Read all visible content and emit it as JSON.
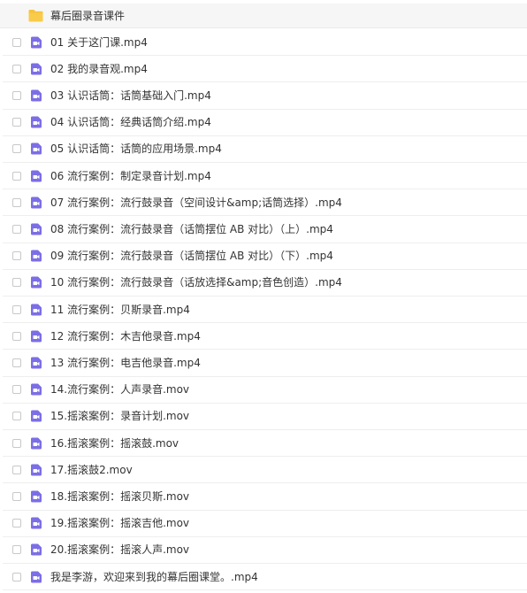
{
  "colors": {
    "folder": "#f7c33c",
    "video": "#7b6ee6",
    "text": "#333333"
  },
  "folder": {
    "icon": "folder-icon",
    "name": "幕后圈录音课件"
  },
  "files": [
    {
      "icon": "video-file-icon",
      "name": "01 关于这门课.mp4"
    },
    {
      "icon": "video-file-icon",
      "name": "02 我的录音观.mp4"
    },
    {
      "icon": "video-file-icon",
      "name": "03 认识话筒：话筒基础入门.mp4"
    },
    {
      "icon": "video-file-icon",
      "name": "04 认识话筒：经典话筒介绍.mp4"
    },
    {
      "icon": "video-file-icon",
      "name": "05 认识话筒：话筒的应用场景.mp4"
    },
    {
      "icon": "video-file-icon",
      "name": "06 流行案例：制定录音计划.mp4"
    },
    {
      "icon": "video-file-icon",
      "name": "07 流行案例：流行鼓录音（空间设计&amp;话筒选择）.mp4"
    },
    {
      "icon": "video-file-icon",
      "name": "08 流行案例：流行鼓录音（话筒摆位 AB 对比）（上）.mp4"
    },
    {
      "icon": "video-file-icon",
      "name": "09 流行案例：流行鼓录音（话筒摆位 AB 对比）（下）.mp4"
    },
    {
      "icon": "video-file-icon",
      "name": "10 流行案例：流行鼓录音（话放选择&amp;音色创造）.mp4"
    },
    {
      "icon": "video-file-icon",
      "name": "11 流行案例：贝斯录音.mp4"
    },
    {
      "icon": "video-file-icon",
      "name": "12 流行案例：木吉他录音.mp4"
    },
    {
      "icon": "video-file-icon",
      "name": "13 流行案例：电吉他录音.mp4"
    },
    {
      "icon": "video-file-icon",
      "name": "14.流行案例：人声录音.mov"
    },
    {
      "icon": "video-file-icon",
      "name": "15.摇滚案例：录音计划.mov"
    },
    {
      "icon": "video-file-icon",
      "name": "16.摇滚案例：摇滚鼓.mov"
    },
    {
      "icon": "video-file-icon",
      "name": "17.摇滚鼓2.mov"
    },
    {
      "icon": "video-file-icon",
      "name": "18.摇滚案例：摇滚贝斯.mov"
    },
    {
      "icon": "video-file-icon",
      "name": "19.摇滚案例：摇滚吉他.mov"
    },
    {
      "icon": "video-file-icon",
      "name": "20.摇滚案例：摇滚人声.mov"
    },
    {
      "icon": "video-file-icon",
      "name": "我是李游，欢迎来到我的幕后圈课堂。.mp4"
    }
  ]
}
